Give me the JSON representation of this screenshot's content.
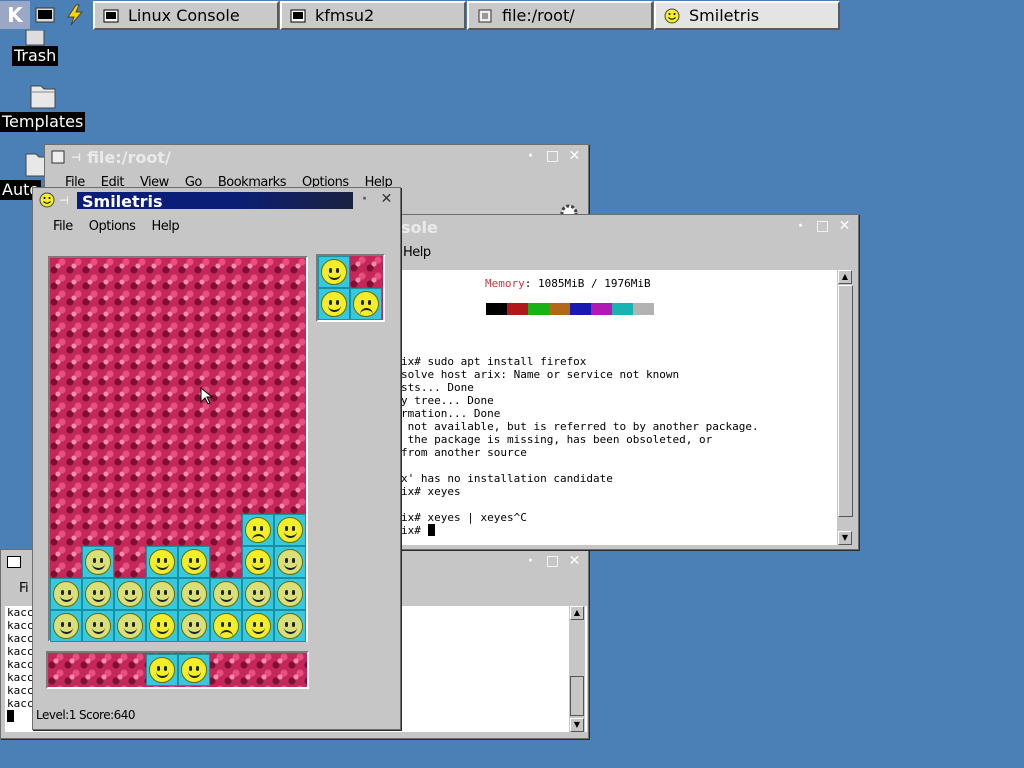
{
  "taskbar": {
    "launchers": [
      {
        "label": "K",
        "icon": "kde-k-icon"
      },
      {
        "label": "",
        "icon": "terminal-launcher-icon"
      },
      {
        "label": "",
        "icon": "lightning-icon"
      },
      {
        "label": "",
        "icon": "file-manager-icon"
      }
    ],
    "tasks": [
      {
        "label": "Linux Console",
        "icon": "console-window-icon"
      },
      {
        "label": "kfmsu2",
        "icon": "console-window-icon"
      },
      {
        "label": "file:/root/",
        "icon": "file-manager-icon"
      },
      {
        "label": "Smiletris",
        "icon": "smiley-icon"
      }
    ]
  },
  "desktop": {
    "icons": [
      {
        "label": "Trash",
        "icon": "trash-icon"
      },
      {
        "label": "Templates",
        "icon": "folder-icon"
      },
      {
        "label": "Auto",
        "icon": "folder-icon"
      }
    ]
  },
  "file_manager": {
    "title": "file:/root/",
    "menu": [
      "File",
      "Edit",
      "View",
      "Go",
      "Bookmarks",
      "Options",
      "Help"
    ]
  },
  "console": {
    "title": "sole",
    "menu": [
      "Help"
    ],
    "memory_label": "Memory",
    "memory_value": ": 1085MiB / 1976MiB",
    "swatches": [
      "#000000",
      "#b21818",
      "#18b218",
      "#b26818",
      "#1818b2",
      "#b218b2",
      "#18b2b2",
      "#b2b2b2"
    ],
    "lines": [
      "ix# sudo apt install firefox",
      "solve host arix: Name or service not known",
      "sts... Done",
      "y tree... Done",
      "rmation... Done",
      " not available, but is referred to by another package.",
      " the package is missing, has been obsoleted, or",
      "from another source",
      "",
      "x' has no installation candidate",
      "ix# xeyes",
      "",
      "ix# xeyes | xeyes^C",
      "ix# "
    ]
  },
  "kfmsu2": {
    "menu_first": "Fi",
    "lines": [
      "kacc",
      "kacc",
      "kacc",
      "kacc",
      "kacc",
      "kacc",
      "kacc",
      "kacc",
      "kacc"
    ]
  },
  "smiletris": {
    "title": "Smiletris",
    "menu": [
      "File",
      "Options",
      "Help"
    ],
    "status_level": "Level:1",
    "status_score": "Score:640"
  }
}
